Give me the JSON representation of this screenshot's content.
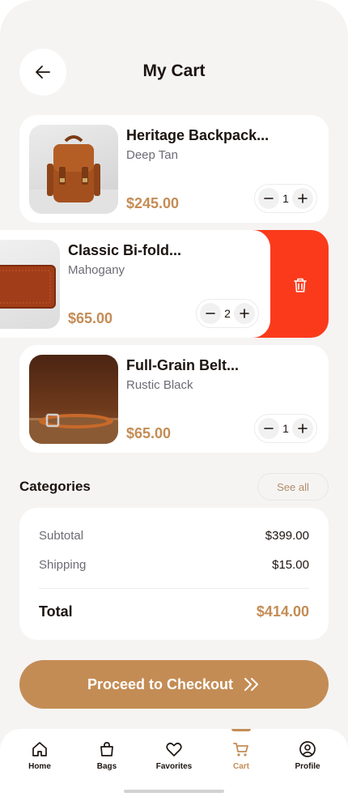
{
  "header": {
    "title": "My Cart"
  },
  "cart": {
    "items": [
      {
        "name": "Heritage Backpack...",
        "variant": "Deep Tan",
        "price": "$245.00",
        "quantity": "1",
        "thumb_icon": "leather-backpack"
      },
      {
        "name": "Classic Bi-fold...",
        "variant": "Mahogany",
        "price": "$65.00",
        "quantity": "2",
        "thumb_icon": "leather-wallet"
      },
      {
        "name": "Full-Grain Belt...",
        "variant": "Rustic Black",
        "price": "$65.00",
        "quantity": "1",
        "thumb_icon": "leather-belt"
      }
    ],
    "delete_icon": "trash-icon"
  },
  "section": {
    "title": "Categories",
    "see_all": "See all"
  },
  "summary": {
    "subtotal_label": "Subtotal",
    "subtotal_value": "$399.00",
    "shipping_label": "Shipping",
    "shipping_value": "$15.00",
    "total_label": "Total",
    "total_value": "$414.00"
  },
  "checkout": {
    "label": "Proceed to Checkout"
  },
  "nav": {
    "items": [
      {
        "label": "Home",
        "icon": "home-icon"
      },
      {
        "label": "Bags",
        "icon": "bag-icon"
      },
      {
        "label": "Favorites",
        "icon": "heart-icon"
      },
      {
        "label": "Cart",
        "icon": "cart-icon",
        "active": true
      },
      {
        "label": "Profile",
        "icon": "user-icon"
      }
    ]
  },
  "colors": {
    "accent": "#c48c55",
    "delete": "#fb3a1c",
    "background": "#f5f4f3",
    "text": "#1c1410",
    "muted": "#6d6a74"
  }
}
